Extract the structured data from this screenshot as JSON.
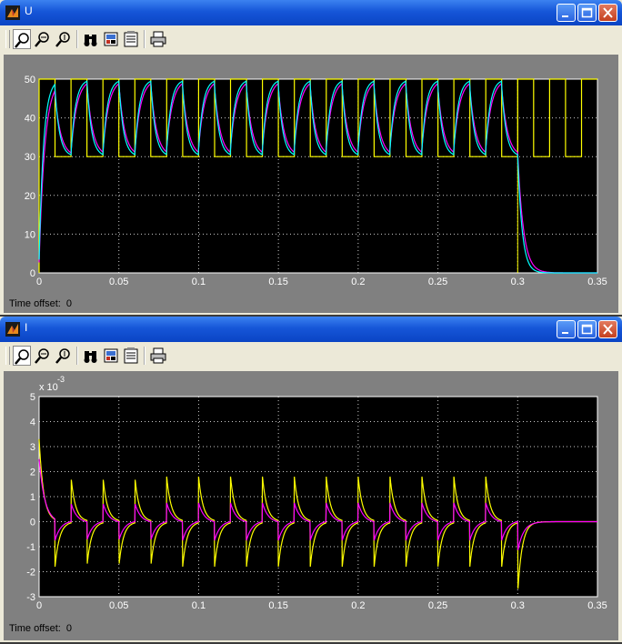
{
  "windows": [
    {
      "id": "U",
      "title": "U",
      "time_offset_label": "Time offset:",
      "time_offset_value": "0"
    },
    {
      "id": "I",
      "title": "I",
      "time_offset_label": "Time offset:",
      "time_offset_value": "0"
    }
  ],
  "toolbar_icons": [
    "zoom-icon",
    "zoom-x-icon",
    "zoom-y-icon",
    "autoscale-icon",
    "save-axes-icon",
    "parameters-icon",
    "print-icon"
  ],
  "colors": {
    "yellow": "#ffff00",
    "magenta": "#ff00ff",
    "cyan": "#00ffff",
    "axes_bg": "#000000",
    "frame": "#808080",
    "titlebar": "#0a44c4"
  },
  "chart_data": [
    {
      "type": "line",
      "title": "",
      "xlabel": "",
      "ylabel": "",
      "xlim": [
        0,
        0.35
      ],
      "ylim": [
        0,
        50
      ],
      "xticks": [
        "0",
        "0.05",
        "0.1",
        "0.15",
        "0.2",
        "0.25",
        "0.3",
        "0.35"
      ],
      "yticks": [
        "0",
        "10",
        "20",
        "30",
        "40",
        "50"
      ],
      "grid": true,
      "square_wave": {
        "low": 30,
        "high": 50,
        "half_period": 0.01,
        "end_time": 0.3,
        "end_value": 0
      },
      "series": [
        {
          "color": "yellow",
          "x": [
            0,
            0,
            0.01,
            0.01,
            0.02,
            0.02,
            0.03,
            0.03,
            0.3,
            0.3,
            0.35
          ],
          "y": [
            0,
            50,
            50,
            30,
            30,
            50,
            50,
            30,
            50,
            0,
            0
          ]
        },
        {
          "color": "magenta",
          "x": [
            0,
            0.005,
            0.01,
            0.012,
            0.02,
            0.022,
            0.03,
            0.29,
            0.3,
            0.305,
            0.31,
            0.35
          ],
          "y": [
            0,
            40,
            48,
            40,
            31,
            40,
            48,
            48,
            31,
            10,
            1,
            0
          ]
        },
        {
          "color": "cyan",
          "x": [
            0,
            0.005,
            0.01,
            0.012,
            0.02,
            0.022,
            0.03,
            0.29,
            0.3,
            0.305,
            0.315,
            0.35
          ],
          "y": [
            0,
            38,
            43,
            38,
            33,
            42,
            47,
            47,
            32,
            13,
            2,
            0
          ]
        }
      ]
    },
    {
      "type": "line",
      "title": "",
      "xlabel": "",
      "ylabel": "",
      "exponent_label": "x 10",
      "exponent_power": "-3",
      "xlim": [
        0,
        0.35
      ],
      "ylim": [
        -3,
        5
      ],
      "xticks": [
        "0",
        "0.05",
        "0.1",
        "0.15",
        "0.2",
        "0.25",
        "0.3",
        "0.35"
      ],
      "yticks": [
        "-3",
        "-2",
        "-1",
        "0",
        "1",
        "2",
        "3",
        "4",
        "5"
      ],
      "grid": true,
      "series": [
        {
          "color": "yellow",
          "x": [
            0,
            0.01,
            0.01,
            0.02,
            0.02,
            0.3,
            0.3,
            0.315,
            0.35
          ],
          "y": [
            3.3,
            -0.3,
            -1.8,
            -0.1,
            1.8,
            -0.1,
            -2.9,
            0,
            0
          ]
        },
        {
          "color": "magenta",
          "x": [
            0,
            0.01,
            0.01,
            0.02,
            0.02,
            0.3,
            0.3,
            0.315,
            0.35
          ],
          "y": [
            2.5,
            -0.1,
            -0.7,
            0,
            0.7,
            0,
            -1.1,
            0,
            0
          ]
        }
      ]
    }
  ]
}
